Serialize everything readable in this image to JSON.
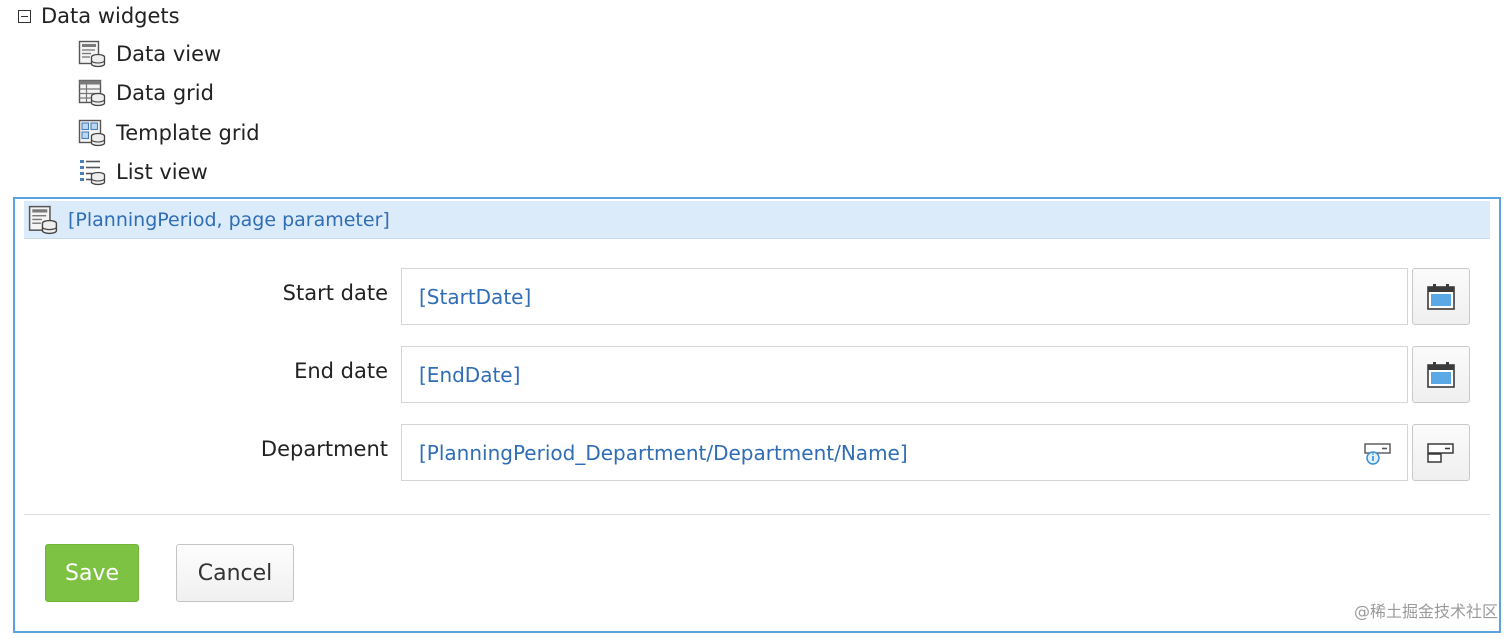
{
  "toolbox": {
    "group_title": "Data widgets",
    "items": [
      {
        "label": "Data view",
        "icon": "data-view-icon"
      },
      {
        "label": "Data grid",
        "icon": "data-grid-icon"
      },
      {
        "label": "Template grid",
        "icon": "template-grid-icon"
      },
      {
        "label": "List view",
        "icon": "list-view-icon"
      }
    ]
  },
  "data_view": {
    "header": "[PlanningPeriod, page parameter]",
    "fields": [
      {
        "label": "Start date",
        "value": "[StartDate]",
        "button_icon": "calendar-icon"
      },
      {
        "label": "End date",
        "value": "[EndDate]",
        "button_icon": "calendar-icon"
      },
      {
        "label": "Department",
        "value": "[PlanningPeriod_Department/Department/Name]",
        "button_icon": "reference-selector-icon"
      }
    ],
    "buttons": {
      "save": "Save",
      "cancel": "Cancel"
    }
  },
  "watermark": "@稀土掘金技术社区",
  "colors": {
    "accent_border": "#5aa3e0",
    "header_bg": "#dcebf9",
    "binding_text": "#2f6db5",
    "save_button": "#7dc242"
  }
}
